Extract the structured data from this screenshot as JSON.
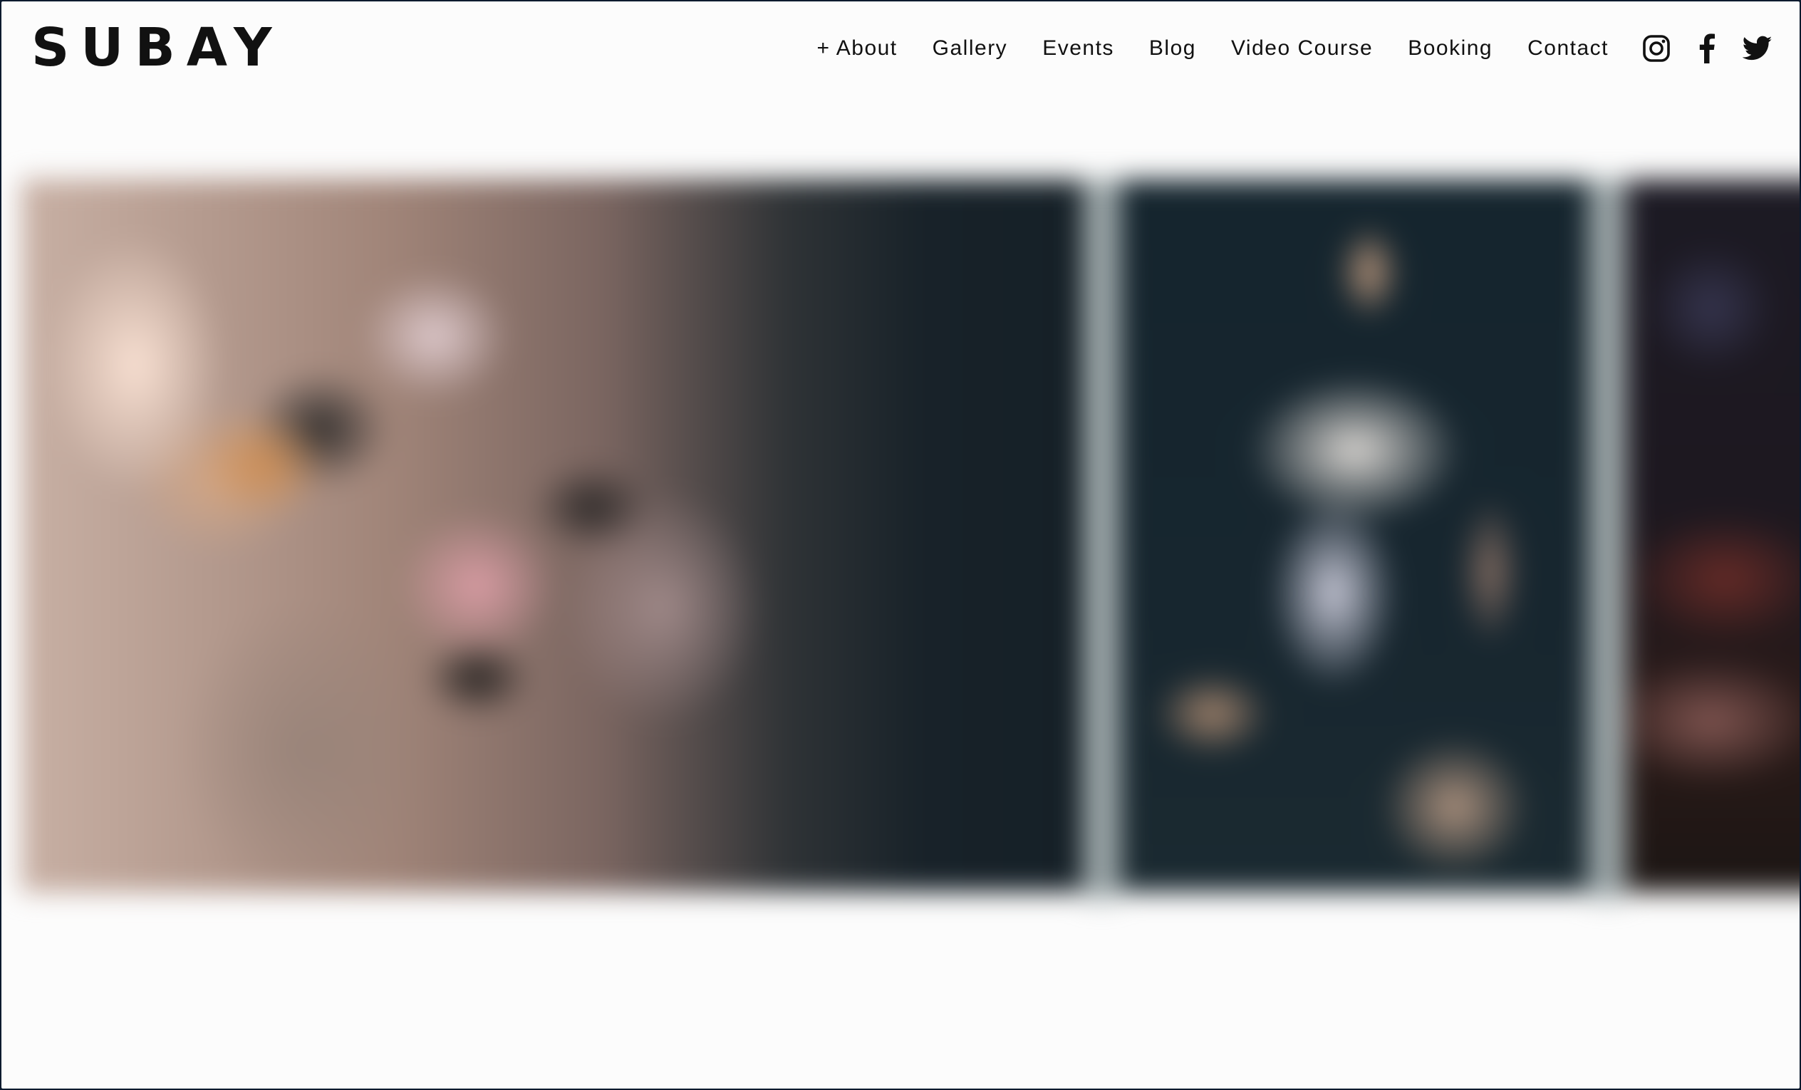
{
  "site": {
    "logo": "SUBAY"
  },
  "nav": {
    "items": [
      {
        "label": "+ About",
        "name": "nav-about"
      },
      {
        "label": "Gallery",
        "name": "nav-gallery"
      },
      {
        "label": "Events",
        "name": "nav-events"
      },
      {
        "label": "Blog",
        "name": "nav-blog"
      },
      {
        "label": "Video Course",
        "name": "nav-video-course"
      },
      {
        "label": "Booking",
        "name": "nav-booking"
      },
      {
        "label": "Contact",
        "name": "nav-contact"
      }
    ]
  },
  "socials": [
    {
      "icon": "instagram-icon"
    },
    {
      "icon": "facebook-icon"
    },
    {
      "icon": "twitter-icon"
    }
  ],
  "gallery": {
    "photos": [
      {
        "name": "gallery-photo-1",
        "dominant_colors": [
          "#c8b0a4",
          "#7a6560",
          "#182229"
        ]
      },
      {
        "name": "gallery-photo-2",
        "dominant_colors": [
          "#17262f",
          "#e6e1dc",
          "#c8a082"
        ]
      },
      {
        "name": "gallery-photo-3",
        "dominant_colors": [
          "#1c1a24",
          "#6e2d28",
          "#1c1614"
        ]
      }
    ]
  },
  "colors": {
    "background": "#fcfcfc",
    "text": "#111111"
  }
}
